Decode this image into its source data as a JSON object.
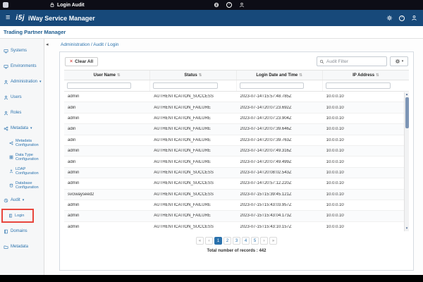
{
  "titlebar": {
    "title": "Login Audit"
  },
  "header": {
    "logo": "i5j",
    "title": "iWay Service Manager",
    "subtitle": "Trading Partner Manager"
  },
  "icons": {
    "hamburger": "≡",
    "caret_down": "▾",
    "sort": "⇅",
    "collapse_left": "◂",
    "clear_x": "×",
    "help": "?",
    "scroll_up": "▴",
    "scroll_down": "▾"
  },
  "sidebar": {
    "items": [
      {
        "label": "Systems"
      },
      {
        "label": "Environments"
      },
      {
        "label": "Administration"
      },
      {
        "label": "Users"
      },
      {
        "label": "Roles"
      },
      {
        "label": "Metadata"
      },
      {
        "label": "Metadata Configuration"
      },
      {
        "label": "Data Type Configuration"
      },
      {
        "label": "LDAP Configuration"
      },
      {
        "label": "Database Configuration"
      },
      {
        "label": "Audit"
      },
      {
        "label": "Login"
      },
      {
        "label": "Domains"
      },
      {
        "label": "Metadata"
      }
    ]
  },
  "main": {
    "breadcrumb": "Administration / Audit / Login",
    "toolbar": {
      "clear_all_label": "Clear All",
      "search_placeholder": "Audit Filter"
    },
    "table": {
      "columns": [
        "User Name",
        "Status",
        "Login Date and Time",
        "IP Address"
      ],
      "rows": [
        [
          "admin",
          "AUTHENTICATION_SUCCESS",
          "2023-07-14T15:57:48.785Z",
          "10.0.0.10"
        ],
        [
          "adin",
          "AUTHENTICATION_FAILURE",
          "2023-07-14T20:07:23.692Z",
          "10.0.0.10"
        ],
        [
          "admin",
          "AUTHENTICATION_FAILURE",
          "2023-07-14T20:07:23.904Z",
          "10.0.0.10"
        ],
        [
          "adin",
          "AUTHENTICATION_FAILURE",
          "2023-07-14T20:07:39.646Z",
          "10.0.0.10"
        ],
        [
          "adin",
          "AUTHENTICATION_FAILURE",
          "2023-07-14T20:07:39.763Z",
          "10.0.0.10"
        ],
        [
          "admin",
          "AUTHENTICATION_FAILURE",
          "2023-07-14T20:07:49.316Z",
          "10.0.0.10"
        ],
        [
          "adin",
          "AUTHENTICATION_FAILURE",
          "2023-07-14T20:07:49.499Z",
          "10.0.0.10"
        ],
        [
          "admin",
          "AUTHENTICATION_SUCCESS",
          "2023-07-14T20:08:02.543Z",
          "10.0.0.10"
        ],
        [
          "admin",
          "AUTHENTICATION_SUCCESS",
          "2023-07-14T20:57:12.220Z",
          "10.0.0.10"
        ],
        [
          "svciwayseed2",
          "AUTHENTICATION_SUCCESS",
          "2023-07-15T15:39:45.121Z",
          "10.0.0.10"
        ],
        [
          "admin",
          "AUTHENTICATION_FAILURE",
          "2023-07-15T15:43:03.957Z",
          "10.0.0.10"
        ],
        [
          "admin",
          "AUTHENTICATION_FAILURE",
          "2023-07-15T15:43:04.173Z",
          "10.0.0.10"
        ],
        [
          "admin",
          "AUTHENTICATION_SUCCESS",
          "2023-07-15T15:43:10.157Z",
          "10.0.0.10"
        ]
      ]
    },
    "pagination": {
      "first": "«",
      "prev": "‹",
      "pages": [
        "1",
        "2",
        "3",
        "4",
        "5"
      ],
      "active_page": "1",
      "next": "›",
      "last": "»"
    },
    "total_label": "Total number of records : 442"
  },
  "colors": {
    "titlebar_black": "#0d0d16",
    "header_navy": "#17497a",
    "accent_blue": "#2a72ad",
    "active_outline_red": "#e8453c",
    "clear_x_red": "#d9534f"
  }
}
